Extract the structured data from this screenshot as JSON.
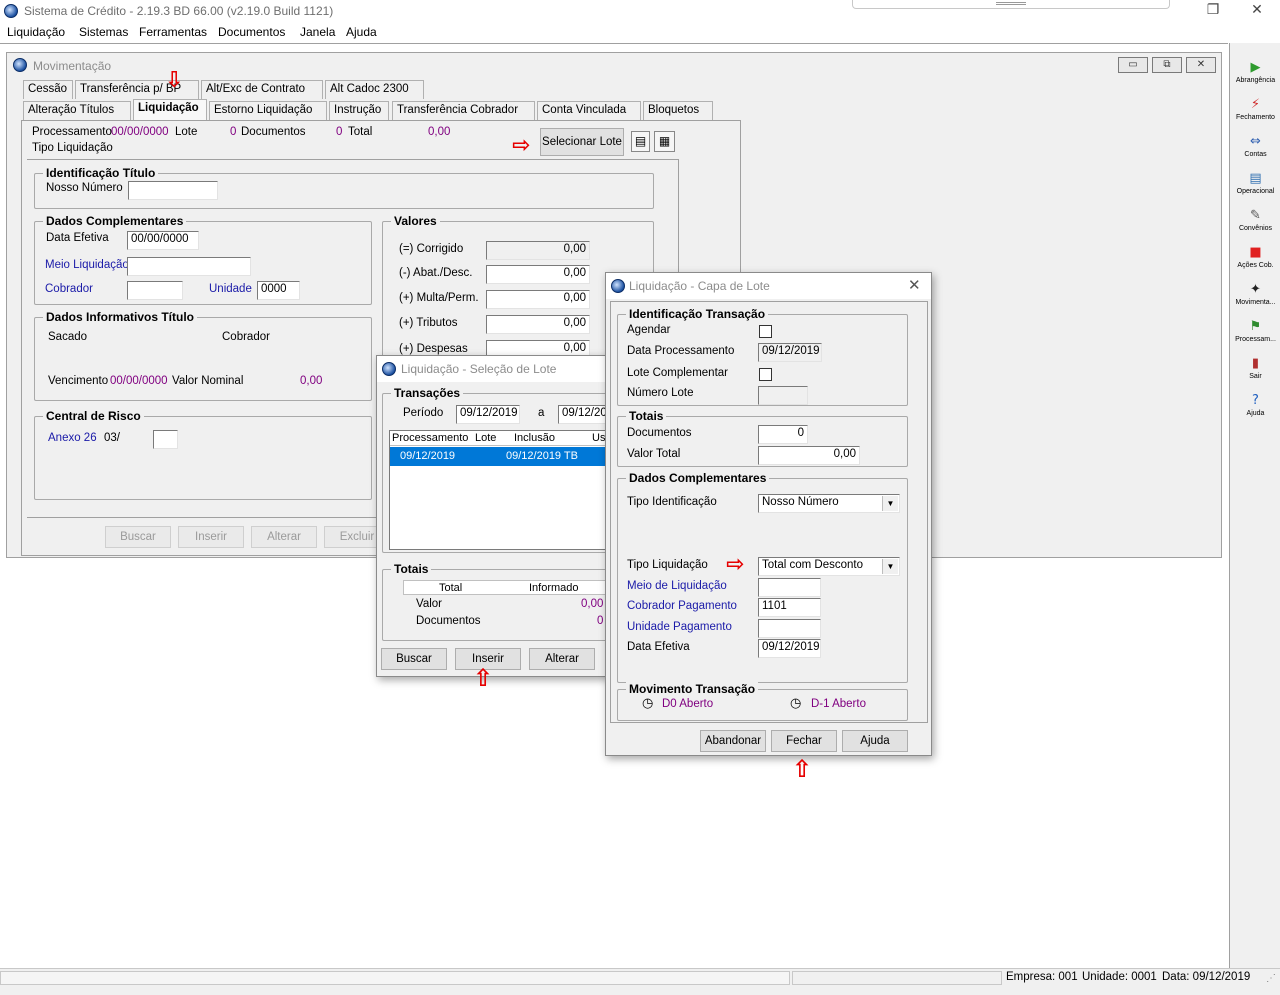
{
  "app": {
    "title": "Sistema de Crédito - 2.19.3 BD 66.00 (v2.19.0 Build 1121)",
    "window_controls": {
      "minimize": "—",
      "restore": "❐",
      "close": "✕"
    }
  },
  "menu": [
    "Liquidação",
    "Sistemas",
    "Ferramentas",
    "Documentos",
    "Janela",
    "Ajuda"
  ],
  "toolbar_right": [
    {
      "label": "Abrangência",
      "icon": "play-green-icon",
      "glyph": "▶",
      "color": "#2e9b2e"
    },
    {
      "label": "Fechamento",
      "icon": "lightning-icon",
      "glyph": "⚡",
      "color": "#d03030"
    },
    {
      "label": "Contas",
      "icon": "arrows-icon",
      "glyph": "⇔",
      "color": "#2f5fb0"
    },
    {
      "label": "Operacional",
      "icon": "document-chart-icon",
      "glyph": "▤",
      "color": "#2f6fb0"
    },
    {
      "label": "Convênios",
      "icon": "edit-document-icon",
      "glyph": "✎",
      "color": "#555555"
    },
    {
      "label": "Ações Cob.",
      "icon": "red-square-icon",
      "glyph": "■",
      "color": "#e02020"
    },
    {
      "label": "Movimenta...",
      "icon": "runner-icon",
      "glyph": "✦",
      "color": "#222222"
    },
    {
      "label": "Processam...",
      "icon": "flag-icon",
      "glyph": "⚑",
      "color": "#2e8b2e"
    },
    {
      "label": "Sair",
      "icon": "exit-door-icon",
      "glyph": "▮",
      "color": "#b03030"
    },
    {
      "label": "Ajuda",
      "icon": "help-icon",
      "glyph": "?",
      "color": "#2060c0"
    }
  ],
  "status": {
    "empresa": "Empresa: 001",
    "unidade": "Unidade: 0001",
    "data": "Data:  09/12/2019"
  },
  "movimentacao": {
    "title": "Movimentação",
    "tabs_row1": [
      "Cessão",
      "Transferência p/ BP",
      "Alt/Exc de Contrato",
      "Alt Cadoc 2300"
    ],
    "tabs_row2": [
      "Alteração Títulos",
      "Liquidação",
      "Estorno Liquidação",
      "Instrução",
      "Transferência Cobrador",
      "Conta Vinculada",
      "Bloquetos"
    ],
    "header": {
      "processamento_label": "Processamento",
      "processamento_value": "00/00/0000",
      "lote_label": "Lote",
      "lote_value": "0",
      "documentos_label": "Documentos",
      "documentos_value": "0",
      "total_label": "Total",
      "total_value": "0,00",
      "tipo_liquidacao_label": "Tipo Liquidação",
      "selecionar_lote": "Selecionar Lote"
    },
    "identificacao": {
      "title": "Identificação Título",
      "nosso_numero_label": "Nosso Número",
      "nosso_numero_value": ""
    },
    "complementares": {
      "title": "Dados Complementares",
      "data_efetiva_label": "Data Efetiva",
      "data_efetiva_value": "00/00/0000",
      "meio_liquidacao_label": "Meio Liquidação",
      "cobrador_label": "Cobrador",
      "unidade_label": "Unidade",
      "unidade_value": "0000"
    },
    "valores": {
      "title": "Valores",
      "rows": [
        {
          "label": "(=) Corrigido",
          "value": "0,00"
        },
        {
          "label": "(-) Abat./Desc.",
          "value": "0,00"
        },
        {
          "label": "(+) Multa/Perm.",
          "value": "0,00"
        },
        {
          "label": "(+) Tributos",
          "value": "0,00"
        },
        {
          "label": "(+) Despesas",
          "value": "0,00"
        }
      ]
    },
    "informativos": {
      "title": "Dados Informativos Título",
      "sacado_label": "Sacado",
      "cobrador_label": "Cobrador",
      "vencimento_label": "Vencimento",
      "vencimento_value": "00/00/0000",
      "valor_nominal_label": "Valor Nominal",
      "valor_nominal_value": "0,00"
    },
    "central_risco": {
      "title": "Central de Risco",
      "anexo_label": "Anexo 26",
      "anexo_value": "03/"
    },
    "buttons": {
      "buscar": "Buscar",
      "inserir": "Inserir",
      "alterar": "Alterar",
      "excluir": "Excluir"
    }
  },
  "selecao_lote": {
    "title": "Liquidação - Seleção de Lote",
    "transacoes_title": "Transações",
    "periodo_label": "Período",
    "periodo_de": "09/12/2019",
    "a_label": "a",
    "periodo_ate": "09/12/20",
    "grid_headers": [
      "Processamento",
      "Lote",
      "Inclusão",
      "Us"
    ],
    "grid_row": {
      "processamento": "09/12/2019",
      "inclusao": "09/12/2019 TB"
    },
    "totais_title": "Totais",
    "totais_headers": [
      "Total",
      "Informado"
    ],
    "valor_label": "Valor",
    "valor_value": "0,00",
    "documentos_label": "Documentos",
    "documentos_value": "0",
    "buttons": {
      "buscar": "Buscar",
      "inserir": "Inserir",
      "alterar": "Alterar"
    }
  },
  "capa_lote": {
    "title": "Liquidação - Capa de Lote",
    "identificacao": {
      "title": "Identificação Transação",
      "agendar_label": "Agendar",
      "data_processamento_label": "Data Processamento",
      "data_processamento_value": "09/12/2019",
      "lote_complementar_label": "Lote Complementar",
      "numero_lote_label": "Número Lote"
    },
    "totais": {
      "title": "Totais",
      "documentos_label": "Documentos",
      "documentos_value": "0",
      "valor_total_label": "Valor Total",
      "valor_total_value": "0,00"
    },
    "complementares": {
      "title": "Dados Complementares",
      "tipo_identificacao_label": "Tipo Identificação",
      "tipo_identificacao_value": "Nosso Número",
      "tipo_liquidacao_label": "Tipo Liquidação",
      "tipo_liquidacao_value": "Total com Desconto",
      "meio_liquidacao_label": "Meio de Liquidação",
      "cobrador_pagamento_label": "Cobrador Pagamento",
      "cobrador_pagamento_value": "1101",
      "unidade_pagamento_label": "Unidade Pagamento",
      "data_efetiva_label": "Data Efetiva",
      "data_efetiva_value": "09/12/2019"
    },
    "movimento": {
      "title": "Movimento Transação",
      "d0": "D0 Aberto",
      "d1": "D-1 Aberto"
    },
    "buttons": {
      "abandonar": "Abandonar",
      "fechar": "Fechar",
      "ajuda": "Ajuda"
    }
  }
}
